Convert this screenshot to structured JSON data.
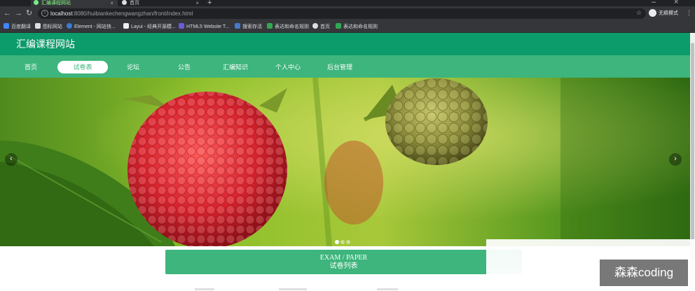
{
  "browser": {
    "tabs": [
      {
        "title": "汇编课程网站",
        "active": true
      },
      {
        "title": "首页",
        "active": false
      }
    ],
    "url": {
      "host": "localhost",
      "rest": ":8080/huibiankechengwangzhan/front/index.html"
    },
    "profile_label": "无痕模式",
    "bookmarks": [
      "百度翻译",
      "图标网站",
      "Element - 网站快...",
      "Layui - 经典开源模...",
      "HTML5 Website T...",
      "搜索存活",
      "表达和命名规则",
      "首页",
      "表达和命名规则"
    ],
    "bookmark_colors": [
      "#4285f4",
      "#dddddd",
      "#3a7bd5",
      "#eeeeee",
      "#6b5bd6",
      "#4a78c9",
      "#33a852",
      "#dddddd",
      "#33a852"
    ]
  },
  "site": {
    "title": "汇编课程网站",
    "nav": [
      "首页",
      "试卷表",
      "论坛",
      "公告",
      "汇编知识",
      "个人中心",
      "后台管理"
    ],
    "active_nav": "试卷表"
  },
  "carousel": {
    "prev_label": "‹",
    "next_label": "›",
    "slide_count": 3,
    "active_slide": 1
  },
  "section": {
    "title_en": "EXAM / PAPER",
    "title_cn": "试卷列表"
  },
  "watermark": "森森coding",
  "colors": {
    "header_green": "#0c9b6a",
    "nav_green": "#3db57c",
    "chrome_dark": "#202124"
  }
}
